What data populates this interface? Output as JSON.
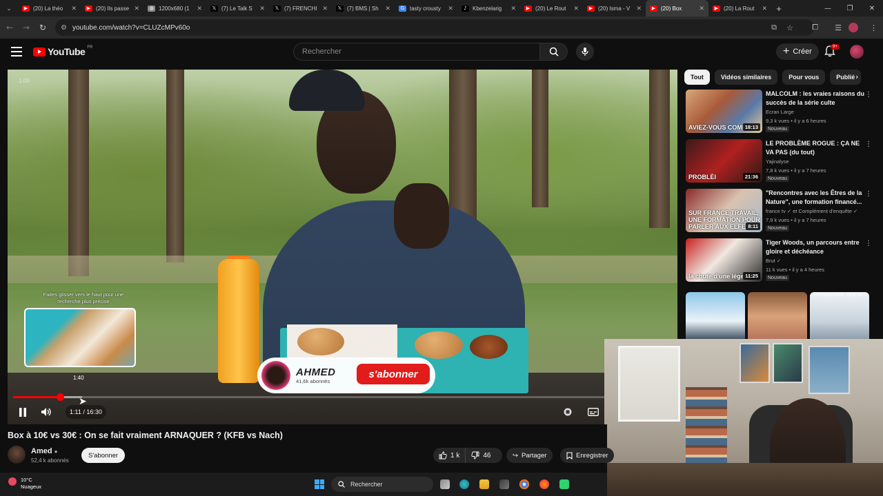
{
  "browser": {
    "tabs": [
      {
        "label": "(20) La théo",
        "icon": "youtube",
        "color": "#ff0000"
      },
      {
        "label": "(20) Ils passe",
        "icon": "youtube",
        "color": "#ff0000"
      },
      {
        "label": "1200x680 (1",
        "icon": "globe",
        "color": "#888888"
      },
      {
        "label": "(7) Le Talk S",
        "icon": "x",
        "color": "#000000"
      },
      {
        "label": "(7) FRENCHI",
        "icon": "x",
        "color": "#000000"
      },
      {
        "label": "(7) BMS | Sh",
        "icon": "x",
        "color": "#000000"
      },
      {
        "label": "tasty crousty",
        "icon": "google",
        "color": "#4285f4"
      },
      {
        "label": "Kbenzelarig",
        "icon": "tiktok",
        "color": "#000000"
      },
      {
        "label": "(20) Le Rout",
        "icon": "youtube",
        "color": "#ff0000"
      },
      {
        "label": "(20) Isma - V",
        "icon": "youtube",
        "color": "#ff0000"
      },
      {
        "label": "(20) Box",
        "icon": "youtube",
        "color": "#ff0000",
        "active": true
      },
      {
        "label": "(20) La Rout",
        "icon": "youtube",
        "color": "#ff0000"
      }
    ],
    "url": "youtube.com/watch?v=CLUZcMPv60o"
  },
  "yt": {
    "logo_text": "YouTube",
    "country": "FR",
    "search_placeholder": "Rechercher",
    "create_label": "Créer",
    "notif_badge": "9+"
  },
  "player": {
    "speed": "1.00",
    "scrub_hint": "Faites glisser vers le haut pour une recherche plus précise",
    "preview_time": "1:40",
    "current_time": "1:11",
    "duration": "16:30",
    "time_display": "1:11 / 16:30",
    "progress": 0.0717,
    "buffered": 0.105,
    "overlay_channel": "AHMED",
    "overlay_subs": "41,6k abonnés",
    "overlay_subscribe": "s'abonner"
  },
  "video": {
    "title": "Box à 10€ vs 30€ : On se fait vraiment ARNAQUER ? (KFB vs Nach)",
    "channel": "Amed",
    "subscribers": "52,4 k abonnés",
    "subscribe_label": "S'abonner",
    "likes": "1 k",
    "dislikes": "46",
    "share_label": "Partager",
    "save_label": "Enregistrer"
  },
  "sidebar": {
    "chips": [
      "Tout",
      "Vidéos similaires",
      "Pour vous",
      "Publié"
    ],
    "recommendations": [
      {
        "title": "MALCOLM : les vraies raisons du succès de la série culte",
        "channel": "Ecran Large",
        "meta": "9,3 k vues • il y a 6 heures",
        "badge": "Nouveau",
        "duration": "18:13",
        "thumb_text": "AVIEZ-VOUS COMPR"
      },
      {
        "title": "LE PROBLÈME ROGUE : ÇA NE VA PAS (du tout)",
        "channel": "Yajinalyse",
        "meta": "7,8 k vues • il y a 7 heures",
        "badge": "Nouveau",
        "duration": "21:36",
        "thumb_text": "PROBLÈI"
      },
      {
        "title": "\"Rencontres avec les Êtres de la Nature\", une formation financé...",
        "channel": "france tv ✓ et Complément d'enquête ✓",
        "meta": "7,9 k vues • il y a 7 heures",
        "badge": "Nouveau",
        "duration": "8:11",
        "thumb_text": "SUR FRANCE TRAVAIL, UNE FORMATION POUR PARLER AUX ELFES"
      },
      {
        "title": "Tiger Woods, un parcours entre gloire et déchéance",
        "channel": "Brut ✓",
        "meta": "11 k vues • il y a 4 heures",
        "badge": "Nouveau",
        "duration": "11:25",
        "thumb_text": "la chute d'une légende"
      }
    ],
    "shorts_label": "ETF MONTANA - CLIP HO"
  },
  "taskbar": {
    "temp": "10°C",
    "weather": "Nuageux",
    "search": "Rechercher"
  }
}
